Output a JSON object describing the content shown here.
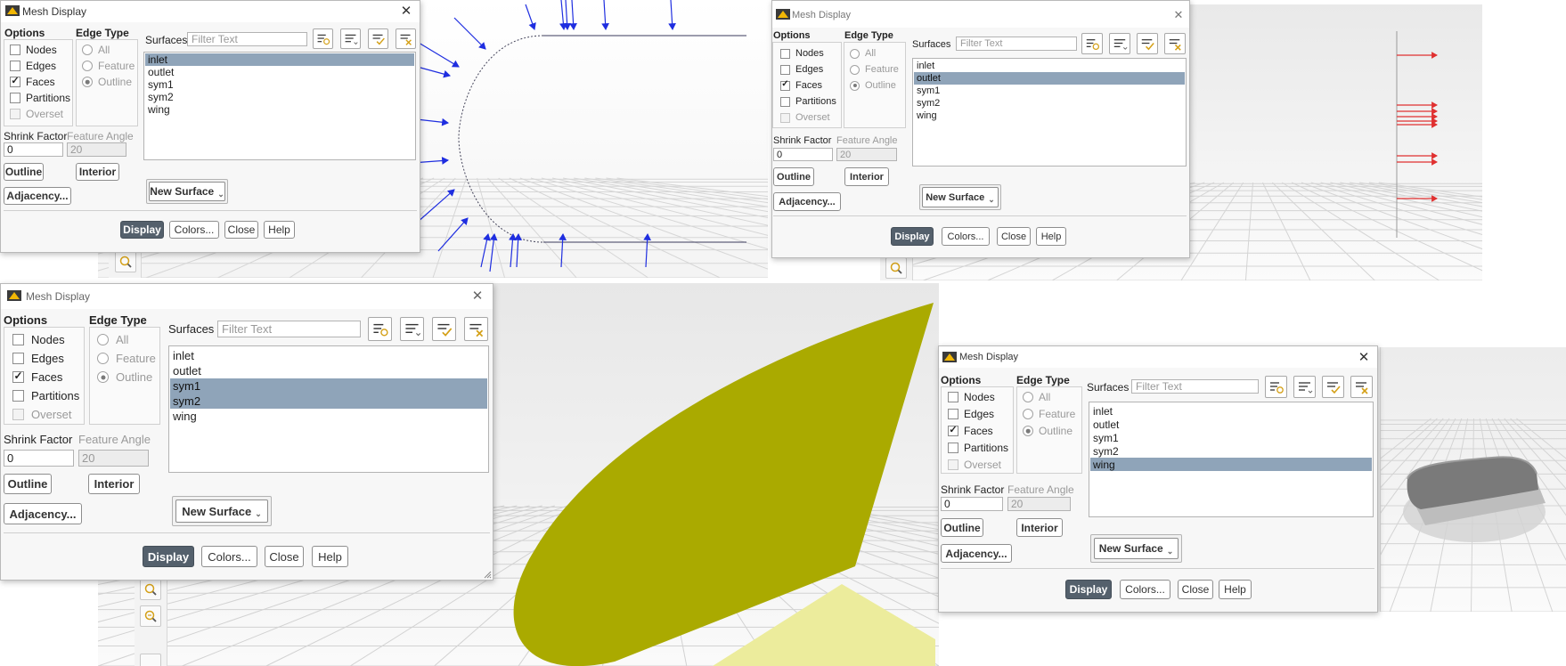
{
  "panels": [
    {
      "dialog": {
        "title": "Mesh Display",
        "close_glyph": "✕",
        "options_label": "Options",
        "edge_type_label": "Edge Type",
        "options": [
          {
            "label": "Nodes",
            "checked": false,
            "enabled": true
          },
          {
            "label": "Edges",
            "checked": false,
            "enabled": true
          },
          {
            "label": "Faces",
            "checked": true,
            "enabled": true
          },
          {
            "label": "Partitions",
            "checked": false,
            "enabled": true
          },
          {
            "label": "Overset",
            "checked": false,
            "enabled": false
          }
        ],
        "edge_types": [
          {
            "label": "All",
            "selected": false
          },
          {
            "label": "Feature",
            "selected": false
          },
          {
            "label": "Outline",
            "selected": true
          }
        ],
        "shrink_factor_label": "Shrink Factor",
        "shrink_factor_value": "0",
        "feature_angle_label": "Feature Angle",
        "feature_angle_value": "20",
        "outline_button": "Outline",
        "interior_button": "Interior",
        "adjacency_button": "Adjacency...",
        "surfaces_label": "Surfaces",
        "filter_placeholder": "Filter Text",
        "surfaces": [
          {
            "label": "inlet",
            "selected": true
          },
          {
            "label": "outlet",
            "selected": false
          },
          {
            "label": "sym1",
            "selected": false
          },
          {
            "label": "sym2",
            "selected": false
          },
          {
            "label": "wing",
            "selected": false
          }
        ],
        "new_surface_button": "New Surface",
        "display_button": "Display",
        "colors_button": "Colors...",
        "close_button": "Close",
        "help_button": "Help"
      }
    },
    {
      "dialog": {
        "title": "Mesh Display",
        "close_glyph": "✕",
        "options_label": "Options",
        "edge_type_label": "Edge Type",
        "options": [
          {
            "label": "Nodes",
            "checked": false,
            "enabled": true
          },
          {
            "label": "Edges",
            "checked": false,
            "enabled": true
          },
          {
            "label": "Faces",
            "checked": true,
            "enabled": true
          },
          {
            "label": "Partitions",
            "checked": false,
            "enabled": true
          },
          {
            "label": "Overset",
            "checked": false,
            "enabled": false
          }
        ],
        "edge_types": [
          {
            "label": "All",
            "selected": false
          },
          {
            "label": "Feature",
            "selected": false
          },
          {
            "label": "Outline",
            "selected": true
          }
        ],
        "shrink_factor_label": "Shrink Factor",
        "shrink_factor_value": "0",
        "feature_angle_label": "Feature Angle",
        "feature_angle_value": "20",
        "outline_button": "Outline",
        "interior_button": "Interior",
        "adjacency_button": "Adjacency...",
        "surfaces_label": "Surfaces",
        "filter_placeholder": "Filter Text",
        "surfaces": [
          {
            "label": "inlet",
            "selected": false
          },
          {
            "label": "outlet",
            "selected": true
          },
          {
            "label": "sym1",
            "selected": false
          },
          {
            "label": "sym2",
            "selected": false
          },
          {
            "label": "wing",
            "selected": false
          }
        ],
        "new_surface_button": "New Surface",
        "display_button": "Display",
        "colors_button": "Colors...",
        "close_button": "Close",
        "help_button": "Help"
      }
    },
    {
      "dialog": {
        "title": "Mesh Display",
        "close_glyph": "✕",
        "options_label": "Options",
        "edge_type_label": "Edge Type",
        "options": [
          {
            "label": "Nodes",
            "checked": false,
            "enabled": true
          },
          {
            "label": "Edges",
            "checked": false,
            "enabled": true
          },
          {
            "label": "Faces",
            "checked": true,
            "enabled": true
          },
          {
            "label": "Partitions",
            "checked": false,
            "enabled": true
          },
          {
            "label": "Overset",
            "checked": false,
            "enabled": false
          }
        ],
        "edge_types": [
          {
            "label": "All",
            "selected": false
          },
          {
            "label": "Feature",
            "selected": false
          },
          {
            "label": "Outline",
            "selected": true
          }
        ],
        "shrink_factor_label": "Shrink Factor",
        "shrink_factor_value": "0",
        "feature_angle_label": "Feature Angle",
        "feature_angle_value": "20",
        "outline_button": "Outline",
        "interior_button": "Interior",
        "adjacency_button": "Adjacency...",
        "surfaces_label": "Surfaces",
        "filter_placeholder": "Filter Text",
        "surfaces": [
          {
            "label": "inlet",
            "selected": false
          },
          {
            "label": "outlet",
            "selected": false
          },
          {
            "label": "sym1",
            "selected": true
          },
          {
            "label": "sym2",
            "selected": true
          },
          {
            "label": "wing",
            "selected": false
          }
        ],
        "new_surface_button": "New Surface",
        "display_button": "Display",
        "colors_button": "Colors...",
        "close_button": "Close",
        "help_button": "Help"
      }
    },
    {
      "dialog": {
        "title": "Mesh Display",
        "close_glyph": "✕",
        "options_label": "Options",
        "edge_type_label": "Edge Type",
        "options": [
          {
            "label": "Nodes",
            "checked": false,
            "enabled": true
          },
          {
            "label": "Edges",
            "checked": false,
            "enabled": true
          },
          {
            "label": "Faces",
            "checked": true,
            "enabled": true
          },
          {
            "label": "Partitions",
            "checked": false,
            "enabled": true
          },
          {
            "label": "Overset",
            "checked": false,
            "enabled": false
          }
        ],
        "edge_types": [
          {
            "label": "All",
            "selected": false
          },
          {
            "label": "Feature",
            "selected": false
          },
          {
            "label": "Outline",
            "selected": true
          }
        ],
        "shrink_factor_label": "Shrink Factor",
        "shrink_factor_value": "0",
        "feature_angle_label": "Feature Angle",
        "feature_angle_value": "20",
        "outline_button": "Outline",
        "interior_button": "Interior",
        "adjacency_button": "Adjacency...",
        "surfaces_label": "Surfaces",
        "filter_placeholder": "Filter Text",
        "surfaces": [
          {
            "label": "inlet",
            "selected": false
          },
          {
            "label": "outlet",
            "selected": false
          },
          {
            "label": "sym1",
            "selected": false
          },
          {
            "label": "sym2",
            "selected": false
          },
          {
            "label": "wing",
            "selected": true
          }
        ],
        "new_surface_button": "New Surface",
        "display_button": "Display",
        "colors_button": "Colors...",
        "close_button": "Close",
        "help_button": "Help"
      }
    }
  ],
  "colors": {
    "selection": "#8fa4b9",
    "display_button": "#54606c",
    "inlet_vectors": "#1f2ee0",
    "outlet_vectors": "#e03030",
    "sym_surface": "#aaaa00",
    "sym_shadow": "#ecec9c",
    "wing_surface": "#7a7a7a"
  },
  "icons": [
    "ansys-logo-icon",
    "close-icon",
    "filter-icon",
    "sort-list-icon",
    "select-all-icon",
    "deselect-all-icon",
    "zoom-to-fit-icon",
    "zoom-icon",
    "dropdown-caret-icon"
  ]
}
